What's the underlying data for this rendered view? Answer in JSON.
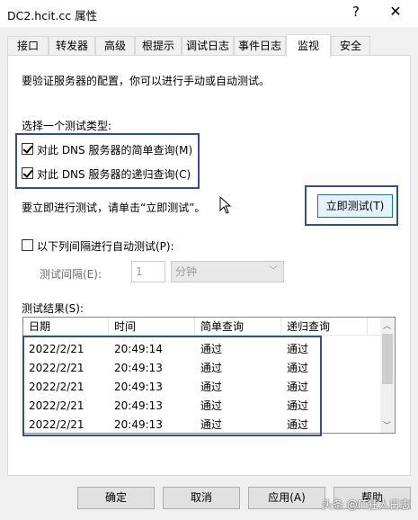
{
  "window": {
    "title": "DC2.hcit.cc 属性",
    "help_label": "?",
    "close_label": "✕"
  },
  "tabs": [
    {
      "label": "接口"
    },
    {
      "label": "转发器"
    },
    {
      "label": "高级"
    },
    {
      "label": "根提示"
    },
    {
      "label": "调试日志"
    },
    {
      "label": "事件日志"
    },
    {
      "label": "监视"
    },
    {
      "label": "安全"
    }
  ],
  "active_tab": "监视",
  "monitor": {
    "intro": "要验证服务器的配置，你可以进行手动或自动测试。",
    "select_type_label": "选择一个测试类型:",
    "simple_query_label": "对此 DNS 服务器的简单查询(M)",
    "simple_query_checked": true,
    "recursive_query_label": "对此 DNS 服务器的递归查询(C)",
    "recursive_query_checked": true,
    "test_now_text": "要立即进行测试，请单击“立即测试”。",
    "test_now_button": "立即测试(T)",
    "auto_test_label": "以下列间隔进行自动测试(P):",
    "auto_test_checked": false,
    "interval_label": "测试间隔(E):",
    "interval_value": "1",
    "interval_unit": "分钟",
    "results_label": "测试结果(S):",
    "results_columns": [
      "日期",
      "时间",
      "简单查询",
      "递归查询"
    ],
    "results_rows": [
      [
        "2022/2/21",
        "20:49:14",
        "通过",
        "通过"
      ],
      [
        "2022/2/21",
        "20:49:13",
        "通过",
        "通过"
      ],
      [
        "2022/2/21",
        "20:49:13",
        "通过",
        "通过"
      ],
      [
        "2022/2/21",
        "20:49:13",
        "通过",
        "通过"
      ],
      [
        "2022/2/21",
        "20:49:13",
        "通过",
        "通过"
      ]
    ]
  },
  "buttons": {
    "ok": "确定",
    "cancel": "取消",
    "apply": "应用(A)",
    "help": "帮助"
  },
  "watermark": "头条 @IT狂人日志",
  "colors": {
    "highlight_border": "#2f4f9a",
    "focus_border": "#0078d7"
  }
}
